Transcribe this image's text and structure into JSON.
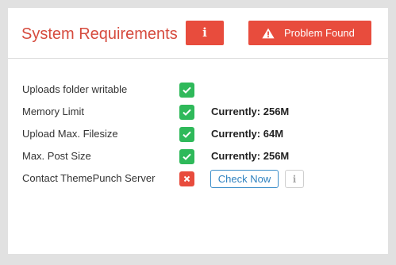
{
  "header": {
    "title": "System Requirements",
    "info_button_glyph": "i",
    "info_button_icon": "info-icon",
    "problem_button_label": "Problem Found",
    "problem_button_icon": "warning-icon"
  },
  "colors": {
    "title": "#d64b3e",
    "danger": "#e84c3d",
    "success": "#2fb95a",
    "link": "#2f82c0"
  },
  "requirements": [
    {
      "label": "Uploads folder writable",
      "status": "ok",
      "status_icon": "check-icon",
      "value": ""
    },
    {
      "label": "Memory Limit",
      "status": "ok",
      "status_icon": "check-icon",
      "value": "Currently: 256M"
    },
    {
      "label": "Upload Max. Filesize",
      "status": "ok",
      "status_icon": "check-icon",
      "value": "Currently: 64M"
    },
    {
      "label": "Max. Post Size",
      "status": "ok",
      "status_icon": "check-icon",
      "value": "Currently: 256M"
    },
    {
      "label": "Contact ThemePunch Server",
      "status": "fail",
      "status_icon": "close-icon",
      "action_label": "Check Now",
      "info_glyph": "i",
      "info_icon": "info-icon"
    }
  ]
}
